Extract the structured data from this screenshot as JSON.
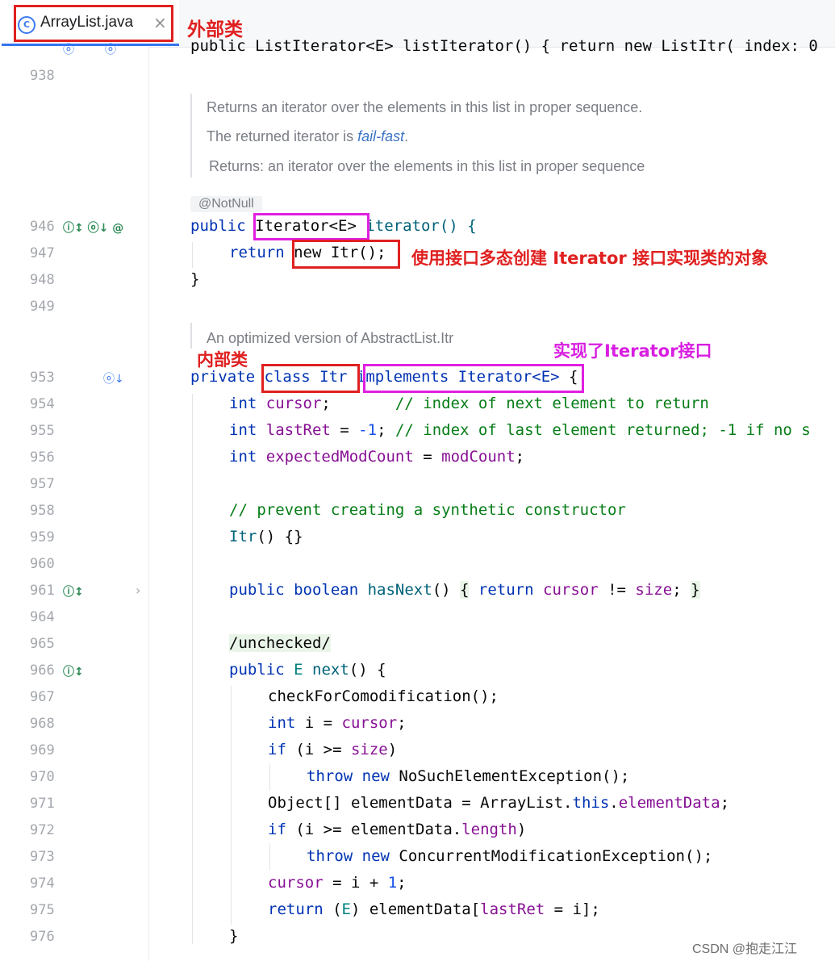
{
  "tab": {
    "icon_letter": "C",
    "title": "ArrayList.java",
    "close": "×"
  },
  "annotations": {
    "outer_class": "外部类",
    "polymorphism": "使用接口多态创建 Iterator 接口实现类的对象",
    "inner_class": "内部类",
    "implements_iterator": "实现了Iterator接口"
  },
  "gutter": {
    "lines": [
      "938",
      "946",
      "947",
      "948",
      "949",
      "953",
      "954",
      "955",
      "956",
      "957",
      "958",
      "959",
      "960",
      "961",
      "964",
      "965",
      "966",
      "967",
      "968",
      "969",
      "970",
      "971",
      "972",
      "973",
      "974",
      "975",
      "976"
    ],
    "icons": {
      "l946": "ⓘ↕ ⓞ↓ @",
      "l953": "ⓞ↓",
      "l961": "ⓘ↕",
      "l966": "ⓘ↕"
    },
    "fold_glyph": "›"
  },
  "doc": {
    "line1": "Returns an iterator over the elements in this list in proper sequence.",
    "line2_prefix": "The returned iterator is ",
    "line2_link": "fail-fast",
    "line2_suffix": ".",
    "line3": "Returns: an iterator over the elements in this list in proper sequence",
    "itr_doc": "An optimized version of AbstractList.Itr"
  },
  "annotation_tag": "@NotNull",
  "code": {
    "l935_partial": "public ListIterator<E> listIterator() { return new ListItr( index: 0",
    "l946_public": "public ",
    "l946_type": "Iterator<E>",
    "l946_rest": " iterator() {",
    "l947_return": "return ",
    "l947_new": "new Itr();",
    "l948": "}",
    "l953_private": "private ",
    "l953_class": "class Itr",
    "l953_impl": "implements Iterator<E>",
    "l953_brace": " {",
    "l954_code": "int cursor;",
    "l954_cmt": "// index of next element to return",
    "l955_code": "int lastRet = -1;",
    "l955_cmt": "// index of last element returned; -1 if no s",
    "l956": "int expectedModCount = modCount;",
    "l958": "// prevent creating a synthetic constructor",
    "l959": "Itr() {}",
    "l961_sig": "public boolean hasNext()",
    "l961_body": " return cursor != size;",
    "l965": "/unchecked/",
    "l966": "public E next() {",
    "l967": "checkForComodification();",
    "l968": "int i = cursor;",
    "l969": "if (i >= size)",
    "l970": "throw new NoSuchElementException();",
    "l971": "Object[] elementData = ArrayList.this.elementData;",
    "l972": "if (i >= elementData.length)",
    "l973": "throw new ConcurrentModificationException();",
    "l974": "cursor = i + 1;",
    "l975": "return (E) elementData[lastRet = i];",
    "l976": "}"
  },
  "watermark": "CSDN @抱走江江",
  "colors": {
    "keyword": "#0033b3",
    "field": "#871094",
    "comment": "#067d17",
    "type_param": "#008080",
    "annotation_red": "#e02020",
    "annotation_magenta": "#e020e0"
  }
}
